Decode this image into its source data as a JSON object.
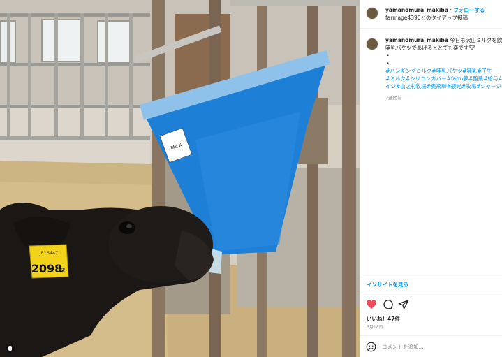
{
  "post": {
    "username": "yamanomura_makiba",
    "separator": "・",
    "follow_label": "フォローする",
    "partner_text": "farmage4390とのタイアップ投稿",
    "caption_username": "yamanomura_makiba",
    "caption_first": "今日も沢山ミルクを飲ん",
    "caption_second": "哺乳バケツであげるととても楽です🐮",
    "dot1": "・",
    "dot2": "・",
    "hashtags1": "#ハンギングミルク#哺乳バケツ#哺乳#子牛",
    "hashtags2": "#ミルク#シリコンカバー#farm夢#酪農#給与#",
    "hashtags3": "イジ#山之村牧場#奥飛騨#観光#牧場#ジャージ",
    "time_ago": "2週間前",
    "insights_label": "インサイトを見る",
    "likes_label": "いいね！47件",
    "date_label": "3月18日",
    "comment_placeholder": "コメントを追加..."
  },
  "photo": {
    "ear_tag_top": "JP16447",
    "ear_tag_number": "2098",
    "ear_tag_suffix": "2",
    "bucket_sticker": "MILK"
  },
  "colors": {
    "like_red": "#ed4956",
    "link_blue": "#0095f6",
    "bucket_blue": "#1e7fd6",
    "tag_yellow": "#f2d21a"
  },
  "icons": [
    "heart-icon",
    "comment-icon",
    "share-icon",
    "emoji-icon",
    "profile-handle-icon"
  ]
}
